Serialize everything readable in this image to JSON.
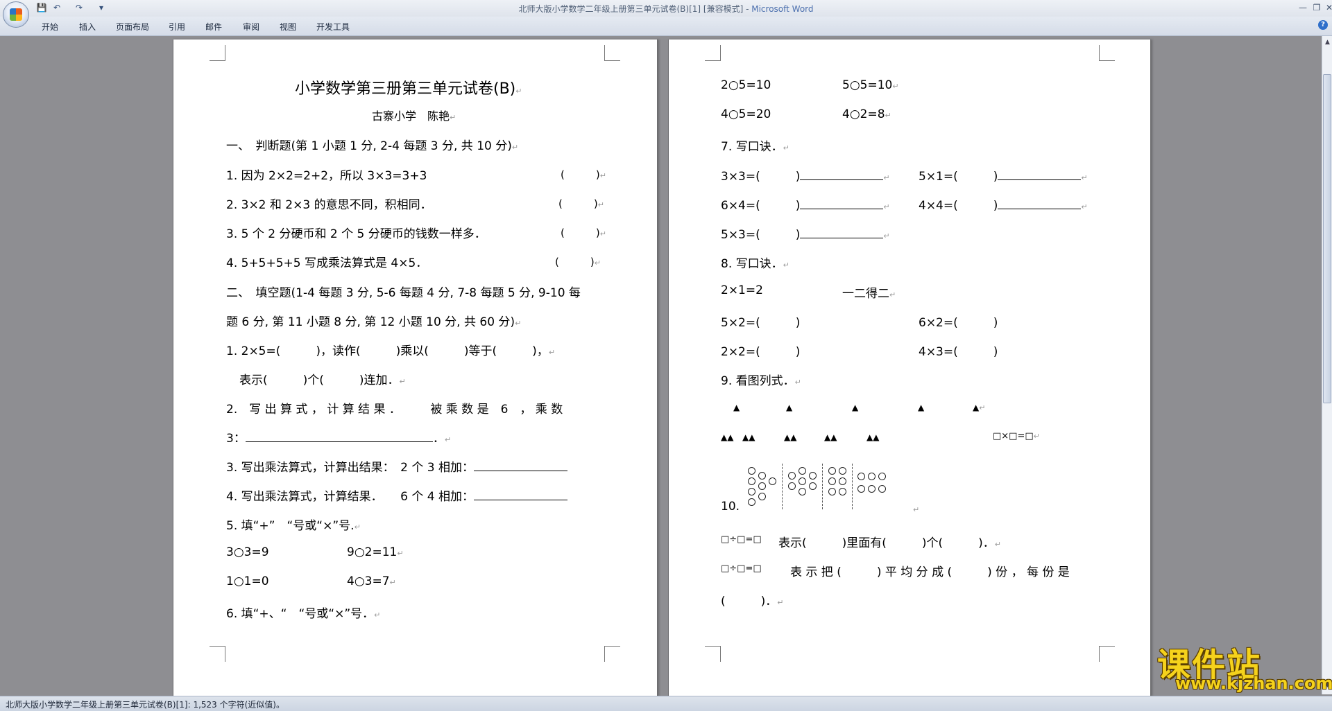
{
  "window": {
    "title": "北师大版小学数学二年级上册第三单元试卷(B)[1] [兼容模式]",
    "app_name": "Microsoft Word",
    "app_separator": " - "
  },
  "qat": {
    "save": "💾",
    "undo": "↶",
    "redo": "↷",
    "more": "▾"
  },
  "window_controls": {
    "minimize": "—",
    "restore": "❐",
    "close": "✕"
  },
  "ribbon_tabs": [
    "开始",
    "插入",
    "页面布局",
    "引用",
    "邮件",
    "审阅",
    "视图",
    "开发工具"
  ],
  "help_icon": "?",
  "page1": {
    "title": "小学数学第三册第三单元试卷(B)",
    "author": "古寨小学　陈艳",
    "sec1_heading": "一、　判断题(第 1 小题 1 分, 2-4 每题 3 分, 共 10 分)",
    "q1": "1. 因为 2×2=2+2，所以 3×3=3+3",
    "q2": "2. 3×2 和 2×3 的意思不同，积相同．",
    "q3": "3. 5 个 2 分硬币和 2 个 5 分硬币的钱数一样多．",
    "q4": "4. 5+5+5+5 写成乘法算式是 4×5．",
    "paren": "(　　　)",
    "sec2_heading_a": "二、　填空题(1-4 每题 3 分, 5-6 每题 4 分, 7-8 每题 5 分, 9-10 每",
    "sec2_heading_b": "题 6 分, 第 11 小题 8 分, 第 12 小题 10 分, 共 60 分)",
    "f1_a": "1. 2×5=(　　　)，读作(　　　)乘以(　　　)等于(　　　)，",
    "f1_b": "表示(　　　)个(　　　)连加．",
    "f2_a": "2.　写 出 算 式 ， 计 算 结 果 ．　　　被 乘 数 是　6　， 乘 数",
    "f2_b": "3：",
    "f2_end": "．",
    "f3": "3. 写出乘法算式，计算出结果：　2 个 3 相加：",
    "f4": "4. 写出乘法算式，计算结果．　　6 个 4 相加：",
    "f5": "5. 填“+”　“号或“×”号.",
    "f5_r1_l": "3○3=9",
    "f5_r1_r": "9○2=11",
    "f5_r2_l": "1○1=0",
    "f5_r2_r": "4○3=7",
    "f6": "6. 填“+、“　“号或“×”号．"
  },
  "page2": {
    "r1_l": "2○5=10",
    "r1_r": "5○5=10",
    "r2_l": "4○5=20",
    "r2_r": "4○2=8",
    "q7": "7. 写口诀．",
    "q7_a1": "3×3=(　　　)",
    "q7_b1": "5×1=(　　　)",
    "q7_a2": "6×4=(　　　)",
    "q7_b2": "4×4=(　　　)",
    "q7_a3": "5×3=(　　　)",
    "q8": "8. 写口诀．",
    "q8_r1_l": "2×1=2",
    "q8_r1_r": "一二得二",
    "q8_r2_l": "5×2=(　　　)",
    "q8_r2_r": "6×2=(　　　)",
    "q8_r3_l": "2×2=(　　　)",
    "q8_r3_r": "4×3=(　　　)",
    "q9": "9. 看图列式．",
    "tri": "▲",
    "tri_pair": "▲▲",
    "box_expr": "□×□=□",
    "q10": "10.",
    "d1_expr": "□÷□=□",
    "d1_text": "表示(　　　)里面有(　　　)个(　　　)．",
    "d2_expr": "□÷□=□",
    "d2_text": "表 示 把 (　　　) 平 均 分 成 (　　　) 份 ， 每 份 是",
    "d3_text": "(　　　)．"
  },
  "paragraph_mark": "↵",
  "status_text": "北师大版小学数学二年级上册第三单元试卷(B)[1]: 1,523 个字符(近似值)。",
  "scroll_arrows": {
    "up": "▲",
    "down": "▼"
  },
  "watermark": {
    "title": "课件站",
    "url": "www.kjzhan.com"
  }
}
